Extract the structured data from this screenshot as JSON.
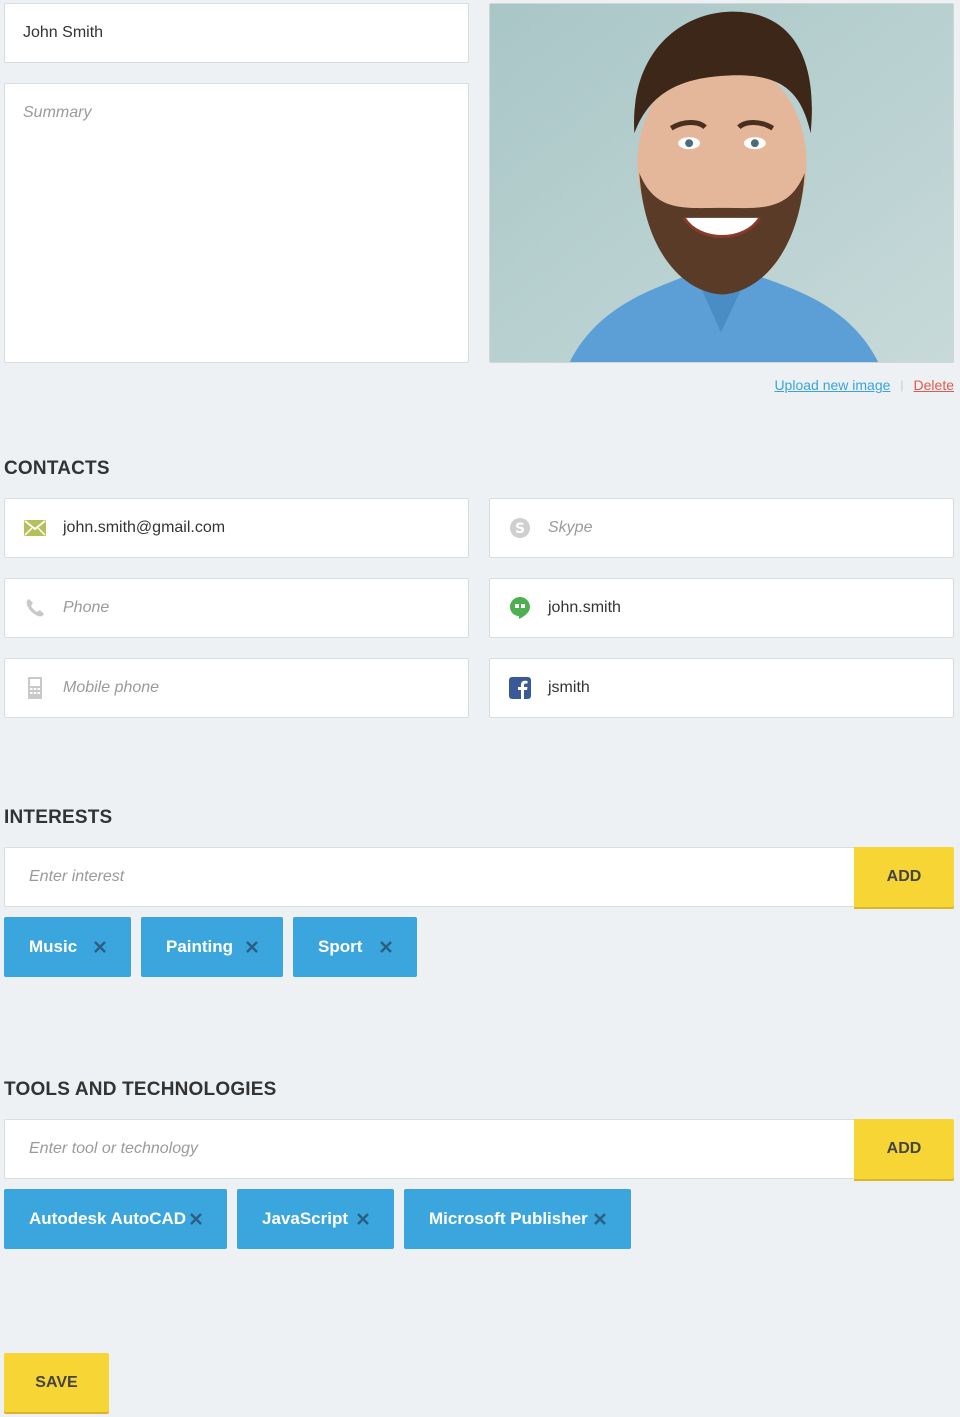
{
  "profile": {
    "name_value": "John Smith",
    "summary_placeholder": "Summary",
    "upload_label": "Upload new image",
    "delete_label": "Delete",
    "separator": "|"
  },
  "contacts": {
    "title": "CONTACTS",
    "email_value": "john.smith@gmail.com",
    "skype_placeholder": "Skype",
    "phone_placeholder": "Phone",
    "hangouts_value": "john.smith",
    "mobile_placeholder": "Mobile phone",
    "facebook_value": "jsmith"
  },
  "interests": {
    "title": "INTERESTS",
    "input_placeholder": "Enter interest",
    "add_label": "ADD",
    "tags": [
      "Music",
      "Painting",
      "Sport"
    ]
  },
  "tools": {
    "title": "TOOLS AND TECHNOLOGIES",
    "input_placeholder": "Enter tool or technology",
    "add_label": "ADD",
    "tags": [
      "Autodesk AutoCAD",
      "JavaScript",
      "Microsoft Publisher"
    ]
  },
  "save_label": "SAVE",
  "colors": {
    "background": "#edf1f4",
    "tag_blue": "#3ba5dd",
    "button_yellow": "#f7d535",
    "link_blue": "#3aa3dc",
    "link_red": "#e05a4e"
  },
  "icons": [
    "envelope-icon",
    "skype-icon",
    "phone-icon",
    "hangouts-icon",
    "mobile-phone-icon",
    "facebook-icon",
    "close-icon"
  ]
}
